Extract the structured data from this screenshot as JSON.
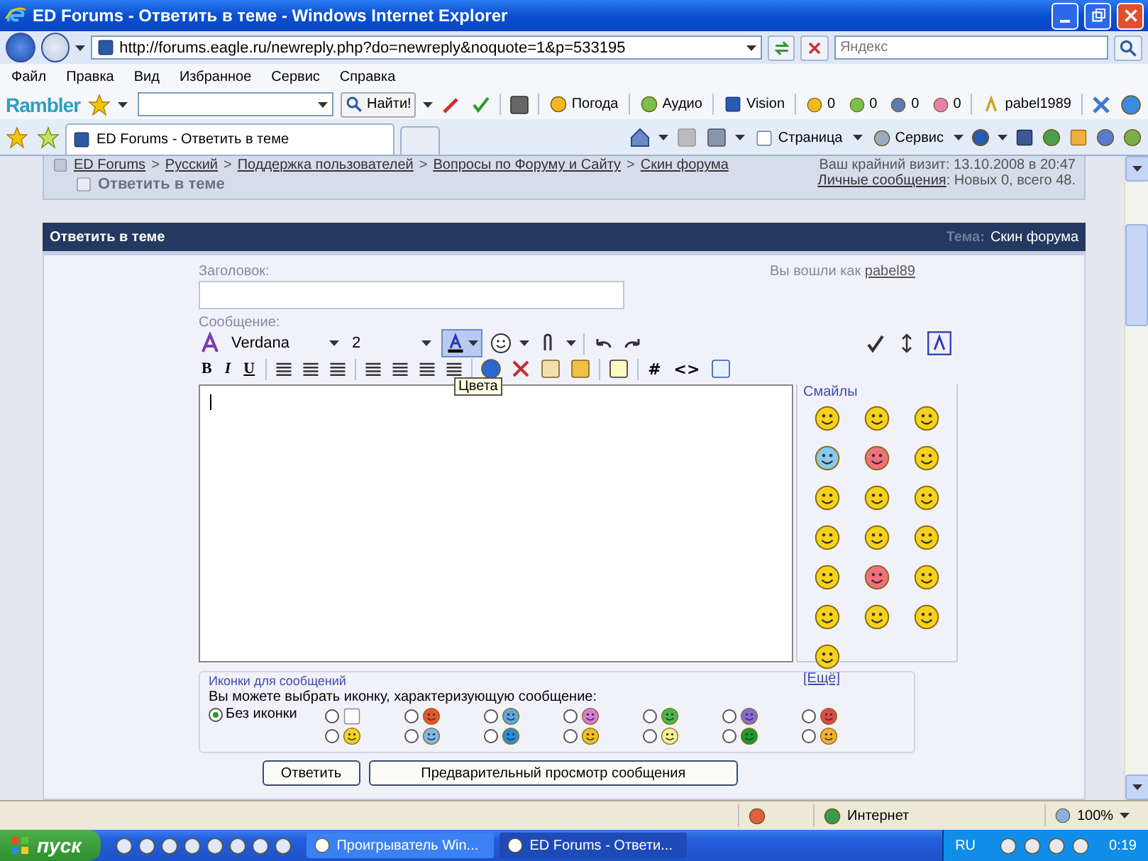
{
  "window": {
    "title": "ED Forums - Ответить в теме - Windows Internet Explorer"
  },
  "address_bar": {
    "url": "http://forums.eagle.ru/newreply.php?do=newreply&noquote=1&p=533195",
    "search_placeholder": "Яндекс"
  },
  "menu": [
    "Файл",
    "Правка",
    "Вид",
    "Избранное",
    "Сервис",
    "Справка"
  ],
  "rambler_toolbar": {
    "logo": "Rambler",
    "search_button": "Найти!",
    "items": [
      {
        "kind": "weather",
        "label": "Погода"
      },
      {
        "kind": "audio",
        "label": "Аудио"
      },
      {
        "kind": "vision",
        "label": "Vision"
      }
    ],
    "counters": [
      "0",
      "0",
      "0",
      "0"
    ],
    "user": "pabel1989"
  },
  "tabs": [
    {
      "label": "ED Forums - Ответить в теме",
      "selected": true
    }
  ],
  "command_bar": [
    "Страница",
    "Сервис"
  ],
  "breadcrumb": {
    "links": [
      {
        "label": "ED Forums"
      },
      {
        "separator": ">",
        "label": "Русский"
      },
      {
        "separator": ">",
        "label": "Поддержка пользователей"
      },
      {
        "separator": ">",
        "label": "Вопросы по Форуму и Сайту"
      },
      {
        "separator": ">",
        "label": "Скин форума"
      }
    ],
    "current": "Ответить в теме"
  },
  "user_panel": {
    "last_visit": "Ваш крайний визит: 13.10.2008 в 20:47",
    "pm_link": "Личные сообщения",
    "pm_counts": ": Новых 0, всего 48."
  },
  "reply_header": {
    "title": "Ответить в теме",
    "topic_label": "Тема:",
    "topic": "Скин форума"
  },
  "form": {
    "title_label": "Заголовок:",
    "logged_in": "Вы вошли как",
    "username": "pabel89",
    "message_label": "Сообщение:",
    "font": "Verdana",
    "size": "2",
    "color_button_selected": true,
    "tooltip": "Цвета",
    "format_buttons": [
      "B",
      "I",
      "U"
    ],
    "code_buttons": [
      "#",
      "<>"
    ],
    "smilies_title": "Смайлы",
    "more_smilies": "[Ещё]"
  },
  "post_icons": {
    "legend": "Иконки для сообщений",
    "hint": "Вы можете выбрать иконку, характеризующую сообщение:",
    "options": [
      {
        "label": "Без иконки",
        "selected": true
      },
      {
        "selected": false
      },
      {
        "selected": false
      },
      {
        "selected": false
      },
      {
        "selected": false
      },
      {
        "selected": false
      },
      {
        "selected": false
      },
      {
        "selected": false
      },
      {
        "selected": false
      },
      {
        "selected": false
      },
      {
        "selected": false
      },
      {
        "selected": false
      },
      {
        "selected": false
      },
      {
        "selected": false
      },
      {
        "selected": false
      }
    ]
  },
  "buttons": [
    "Ответить",
    "Предварительный просмотр сообщения"
  ],
  "status_bar": {
    "zone": "Интернет",
    "zoom": "100%"
  },
  "taskbar": {
    "start": "пуск",
    "windows": [
      {
        "label": "Проигрыватель Win...",
        "selected": false
      },
      {
        "label": "ED Forums - Ответи...",
        "selected": true
      }
    ],
    "language": "RU",
    "clock": "0:19"
  }
}
